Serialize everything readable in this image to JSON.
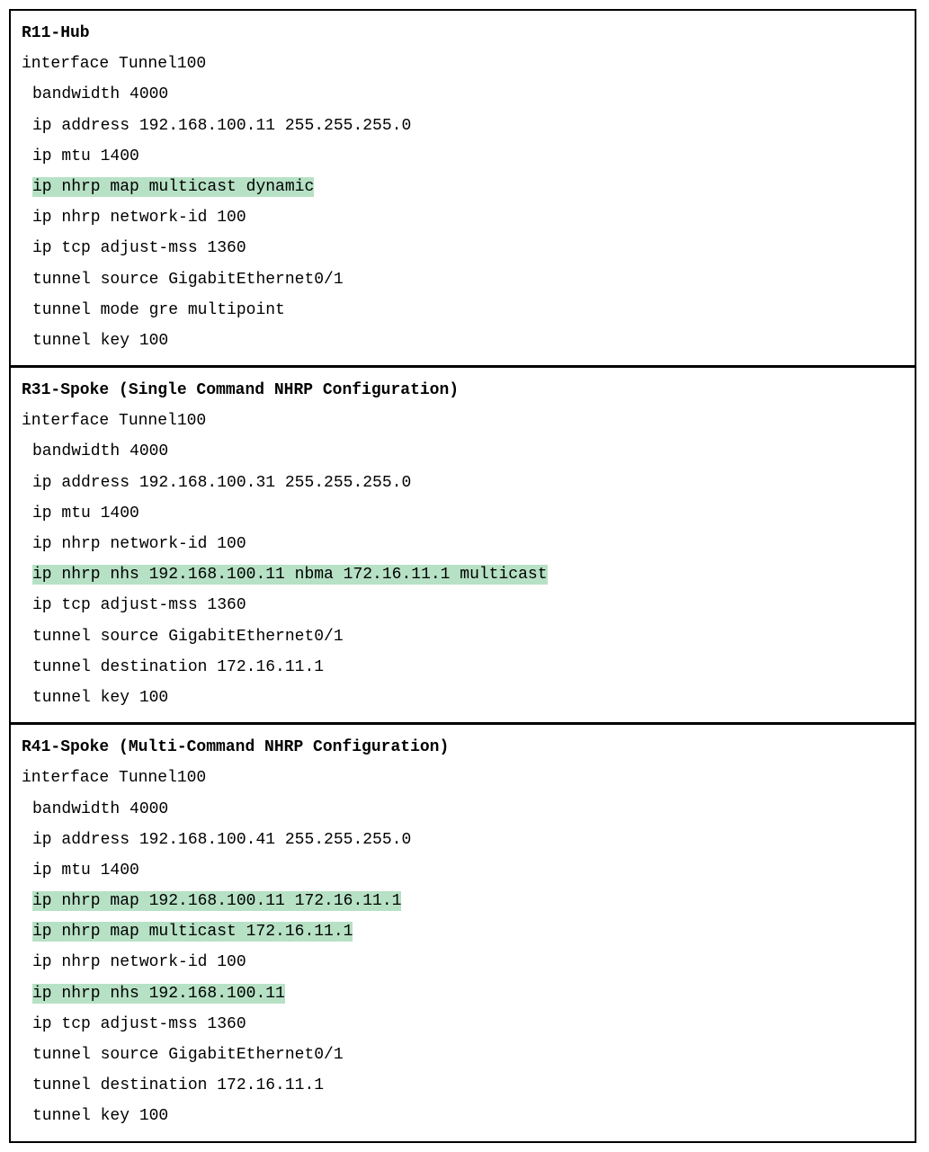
{
  "highlight_color": "#b7e1c5",
  "blocks": [
    {
      "title": "R11-Hub",
      "lines": [
        {
          "text": "interface Tunnel100",
          "indent": 1,
          "highlight": false
        },
        {
          "text": "bandwidth 4000",
          "indent": 2,
          "highlight": false
        },
        {
          "text": "ip address 192.168.100.11 255.255.255.0",
          "indent": 2,
          "highlight": false
        },
        {
          "text": "ip mtu 1400",
          "indent": 2,
          "highlight": false
        },
        {
          "text": "ip nhrp map multicast dynamic",
          "indent": 2,
          "highlight": true
        },
        {
          "text": "ip nhrp network-id 100",
          "indent": 2,
          "highlight": false
        },
        {
          "text": "ip tcp adjust-mss 1360",
          "indent": 2,
          "highlight": false
        },
        {
          "text": "tunnel source GigabitEthernet0/1",
          "indent": 2,
          "highlight": false
        },
        {
          "text": "tunnel mode gre multipoint",
          "indent": 2,
          "highlight": false
        },
        {
          "text": "tunnel key 100",
          "indent": 2,
          "highlight": false
        }
      ]
    },
    {
      "title": "R31-Spoke (Single Command NHRP Configuration)",
      "lines": [
        {
          "text": "interface Tunnel100",
          "indent": 1,
          "highlight": false
        },
        {
          "text": "bandwidth 4000",
          "indent": 2,
          "highlight": false
        },
        {
          "text": "ip address 192.168.100.31 255.255.255.0",
          "indent": 2,
          "highlight": false
        },
        {
          "text": "ip mtu 1400",
          "indent": 2,
          "highlight": false
        },
        {
          "text": "ip nhrp network-id 100",
          "indent": 2,
          "highlight": false
        },
        {
          "text": "ip nhrp nhs 192.168.100.11 nbma 172.16.11.1 multicast",
          "indent": 2,
          "highlight": true
        },
        {
          "text": "ip tcp adjust-mss 1360",
          "indent": 2,
          "highlight": false
        },
        {
          "text": "tunnel source GigabitEthernet0/1",
          "indent": 2,
          "highlight": false
        },
        {
          "text": "tunnel destination 172.16.11.1",
          "indent": 2,
          "highlight": false
        },
        {
          "text": "tunnel key 100",
          "indent": 2,
          "highlight": false
        }
      ]
    },
    {
      "title": "R41-Spoke (Multi-Command NHRP Configuration)",
      "lines": [
        {
          "text": "interface Tunnel100",
          "indent": 1,
          "highlight": false
        },
        {
          "text": "bandwidth 4000",
          "indent": 2,
          "highlight": false
        },
        {
          "text": "ip address 192.168.100.41 255.255.255.0",
          "indent": 2,
          "highlight": false
        },
        {
          "text": "ip mtu 1400",
          "indent": 2,
          "highlight": false
        },
        {
          "text": "ip nhrp map 192.168.100.11 172.16.11.1",
          "indent": 2,
          "highlight": true
        },
        {
          "text": "ip nhrp map multicast 172.16.11.1",
          "indent": 2,
          "highlight": true
        },
        {
          "text": "ip nhrp network-id 100",
          "indent": 2,
          "highlight": false
        },
        {
          "text": "ip nhrp nhs 192.168.100.11",
          "indent": 2,
          "highlight": true
        },
        {
          "text": "ip tcp adjust-mss 1360",
          "indent": 2,
          "highlight": false
        },
        {
          "text": "tunnel source GigabitEthernet0/1",
          "indent": 2,
          "highlight": false
        },
        {
          "text": "tunnel destination 172.16.11.1",
          "indent": 2,
          "highlight": false
        },
        {
          "text": "tunnel key 100",
          "indent": 2,
          "highlight": false
        }
      ]
    }
  ]
}
